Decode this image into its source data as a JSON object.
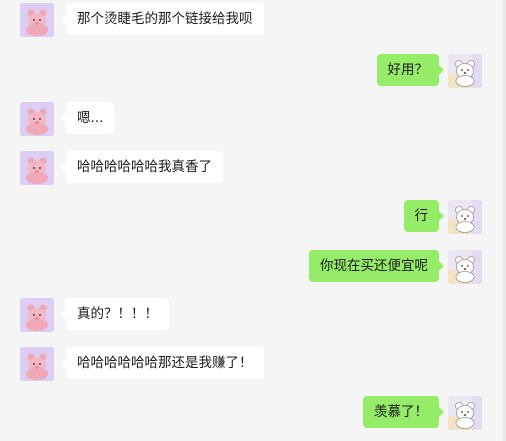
{
  "colors": {
    "background": "#f5f5f5",
    "incoming_bubble": "#ffffff",
    "outgoing_bubble": "#95ec69",
    "text": "#1a1a1a"
  },
  "messages": [
    {
      "side": "left",
      "text": "那个烫睫毛的那个链接给我呗",
      "avatar": "pink-bear-avatar"
    },
    {
      "side": "right",
      "text": "好用？",
      "avatar": "white-bear-avatar"
    },
    {
      "side": "left",
      "text": "嗯...",
      "avatar": "pink-bear-avatar"
    },
    {
      "side": "left",
      "text": "哈哈哈哈哈哈我真香了",
      "avatar": "pink-bear-avatar"
    },
    {
      "side": "right",
      "text": "行",
      "avatar": "white-bear-avatar"
    },
    {
      "side": "right",
      "text": "你现在买还便宜呢",
      "avatar": "white-bear-avatar"
    },
    {
      "side": "left",
      "text": "真的？！！！",
      "avatar": "pink-bear-avatar"
    },
    {
      "side": "left",
      "text": "哈哈哈哈哈哈那还是我赚了！",
      "avatar": "pink-bear-avatar"
    },
    {
      "side": "right",
      "text": "羡慕了！",
      "avatar": "white-bear-avatar"
    }
  ]
}
